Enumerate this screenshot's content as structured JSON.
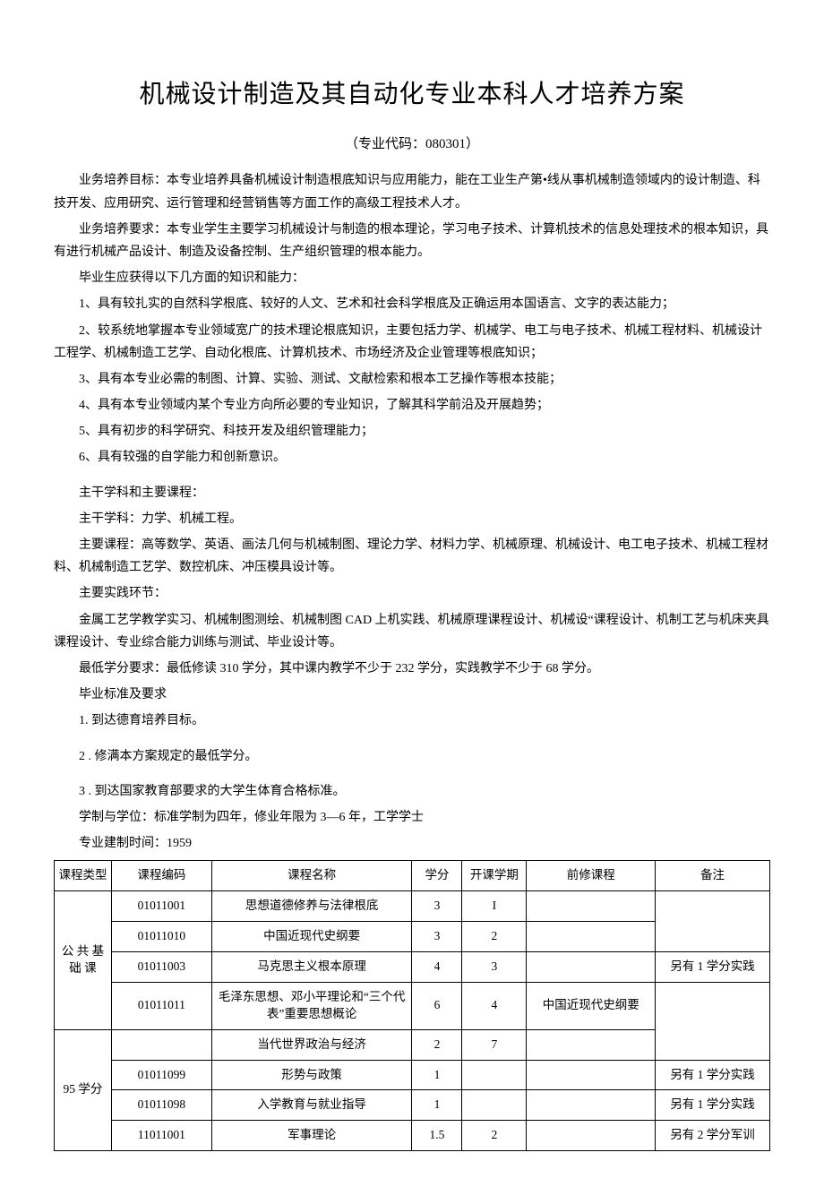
{
  "title": "机械设计制造及其自动化专业本科人才培养方案",
  "subtitle": "（专业代码：080301）",
  "paras": {
    "p1": "业务培养目标：本专业培养具备机械设计制造根底知识与应用能力，能在工业生产第•线从事机械制造领域内的设计制造、科技开发、应用研究、运行管理和经营销售等方面工作的高级工程技术人才。",
    "p2": "业务培养要求：本专业学生主要学习机械设计与制造的根本理论，学习电子技术、计算机技术的信息处理技术的根本知识，具有进行机械产品设计、制造及设备控制、生产组织管理的根本能力。",
    "p3": "毕业生应获得以下几方面的知识和能力：",
    "li1": "1、具有较扎实的自然科学根底、较好的人文、艺术和社会科学根底及正确运用本国语言、文字的表达能力；",
    "li2": "2、较系统地掌握本专业领域宽广的技术理论根底知识，主要包括力学、机械学、电工与电子技术、机械工程材料、机械设计工程学、机械制造工艺学、自动化根底、计算机技术、市场经济及企业管理等根底知识；",
    "li3": "3、具有本专业必需的制图、计算、实验、测试、文献检索和根本工艺操作等根本技能；",
    "li4": "4、具有本专业领域内某个专业方向所必要的专业知识，了解其科学前沿及开展趋势；",
    "li5": "5、具有初步的科学研究、科技开发及组织管理能力；",
    "li6": "6、具有较强的自学能力和创新意识。",
    "p4": "主干学科和主要课程：",
    "p5": "主干学科：力学、机械工程。",
    "p6": "主要课程：高等数学、英语、画法几何与机械制图、理论力学、材料力学、机械原理、机械设计、电工电子技术、机械工程材料、机械制造工艺学、数控机床、冲压模具设计等。",
    "p7": "主要实践环节：",
    "p8": "金属工艺学教学实习、机械制图测绘、机械制图 CAD 上机实践、机械原理课程设计、机械设“课程设计、机制工艺与机床夹具课程设计、专业综合能力训练与测试、毕业设计等。",
    "p9": "最低学分要求：最低修读 310 学分，其中课内教学不少于 232 学分，实践教学不少于 68 学分。",
    "p10": "毕业标准及要求",
    "g1": "1. 到达德育培养目标。",
    "g2": "2  . 修满本方案规定的最低学分。",
    "g3": "3  . 到达国家教育部要求的大学生体育合格标准。",
    "p11": "学制与学位：标准学制为四年，修业年限为 3—6 年，工学学士",
    "p12": "专业建制时间：1959"
  },
  "table": {
    "headers": {
      "type": "课程类型",
      "code": "课程编码",
      "name": "课程名称",
      "credit": "学分",
      "semester": "开课学期",
      "prereq": "前修课程",
      "note": "备注"
    },
    "category1": "公 共 基 础 课",
    "category2": "95 学分",
    "rows": [
      {
        "code": "01011001",
        "name": "思想道德修养与法律根底",
        "credit": "3",
        "sem": "I",
        "pre": "",
        "note": ""
      },
      {
        "code": "01011010",
        "name": "中国近现代史纲要",
        "credit": "3",
        "sem": "2",
        "pre": "",
        "note": ""
      },
      {
        "code": "01011003",
        "name": "马克思主义根本原理",
        "credit": "4",
        "sem": "3",
        "pre": "",
        "note": "另有 1 学分实践"
      },
      {
        "code": "01011011",
        "name": "毛泽东思想、邓小平理论和“三个代表”重要思想概论",
        "credit": "6",
        "sem": "4",
        "pre": "中国近现代史纲要",
        "note": ""
      },
      {
        "code": "",
        "name": "当代世界政治与经济",
        "credit": "2",
        "sem": "7",
        "pre": "",
        "note": ""
      },
      {
        "code": "01011099",
        "name": "形势与政策",
        "credit": "1",
        "sem": "",
        "pre": "",
        "note": "另有 1 学分实践"
      },
      {
        "code": "01011098",
        "name": "入学教育与就业指导",
        "credit": "1",
        "sem": "",
        "pre": "",
        "note": "另有 1 学分实践"
      },
      {
        "code": "11011001",
        "name": "军事理论",
        "credit": "1.5",
        "sem": "2",
        "pre": "",
        "note": "另有 2 学分军训"
      }
    ]
  }
}
